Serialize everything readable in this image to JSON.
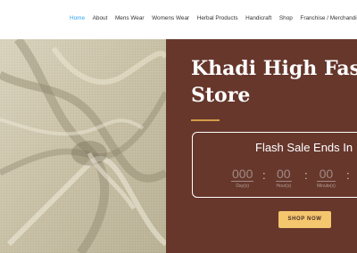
{
  "nav": {
    "items": [
      "Home",
      "About",
      "Mens Wear",
      "Womens Wear",
      "Herbal Products",
      "Handicraft",
      "Shop",
      "Franchise / Merchandi"
    ],
    "active": "Home"
  },
  "hero": {
    "title_line1": "Khadi High Fashi",
    "title_line2": "Store",
    "countdown": {
      "title": "Flash Sale Ends In",
      "days_value": "000",
      "days_label": "Day(s)",
      "hours_value": "00",
      "hours_label": "Hour(s)",
      "minutes_value": "00",
      "minutes_label": "Minute(s)",
      "separator": ":"
    },
    "button_label": "SHOP NOW"
  },
  "colors": {
    "hero_background": "#67372c",
    "accent_gold": "#d29c48",
    "button": "#f4c66e",
    "nav_active": "#2ea3f2"
  }
}
